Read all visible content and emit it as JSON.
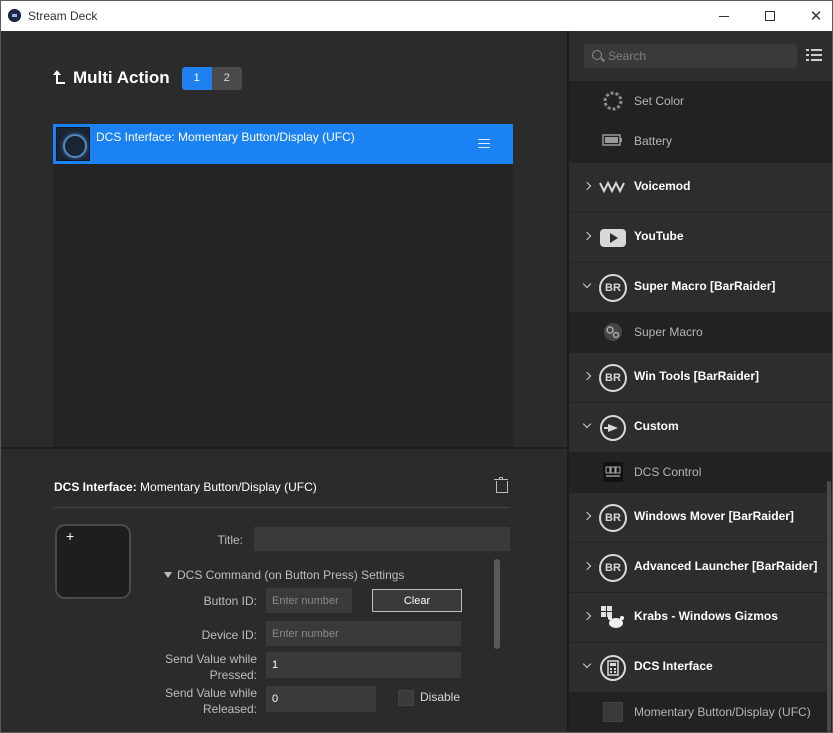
{
  "window": {
    "title": "Stream Deck",
    "close_glyph": "✕"
  },
  "multi_action": {
    "title": "Multi Action",
    "tabs": [
      "1",
      "2"
    ],
    "actions": [
      {
        "label": "DCS Interface: Momentary Button/Display (UFC)"
      }
    ]
  },
  "properties": {
    "header_bold": "DCS Interface:",
    "header_rest": "Momentary Button/Display (UFC)",
    "key_plus": "+",
    "title_label": "Title:",
    "section_label": "DCS Command (on Button Press) Settings",
    "button_id_label": "Button ID:",
    "button_id_placeholder": "Enter number",
    "clear_label": "Clear",
    "device_id_label": "Device ID:",
    "device_id_placeholder": "Enter number",
    "pressed_label_1": "Send Value while",
    "pressed_label_2": "Pressed:",
    "pressed_value": "1",
    "released_label_1": "Send Value while",
    "released_label_2": "Released:",
    "released_value": "0",
    "disable_label": "Disable"
  },
  "sidebar": {
    "search_placeholder": "Search",
    "items": [
      {
        "label": "Set Color",
        "icon": "color-wheel-icon",
        "type": "action"
      },
      {
        "label": "Battery",
        "icon": "battery-icon",
        "type": "action"
      },
      {
        "label": "Voicemod",
        "icon": "voicemod-icon",
        "type": "category",
        "expanded": false
      },
      {
        "label": "YouTube",
        "icon": "youtube-icon",
        "type": "category",
        "expanded": false
      },
      {
        "label": "Super Macro [BarRaider]",
        "icon": "barraider-icon",
        "type": "category",
        "expanded": true
      },
      {
        "label": "Super Macro",
        "icon": "gears-icon",
        "type": "action"
      },
      {
        "label": "Win Tools [BarRaider]",
        "icon": "barraider-icon",
        "type": "category",
        "expanded": false
      },
      {
        "label": "Custom",
        "icon": "custom-plugin-icon",
        "type": "category",
        "expanded": true
      },
      {
        "label": "DCS Control",
        "icon": "dcs-logo-icon",
        "type": "action"
      },
      {
        "label": "Windows Mover [BarRaider]",
        "icon": "barraider-icon",
        "type": "category",
        "expanded": false
      },
      {
        "label": "Advanced Launcher [BarRaider]",
        "icon": "barraider-icon",
        "type": "category",
        "expanded": false
      },
      {
        "label": "Krabs - Windows Gizmos",
        "icon": "krabs-icon",
        "type": "category",
        "expanded": false
      },
      {
        "label": "DCS Interface",
        "icon": "calculator-icon",
        "type": "category",
        "expanded": true
      },
      {
        "label": "Momentary Button/Display (UFC)",
        "icon": "blank-key-icon",
        "type": "action"
      }
    ],
    "br_text": "BR"
  }
}
